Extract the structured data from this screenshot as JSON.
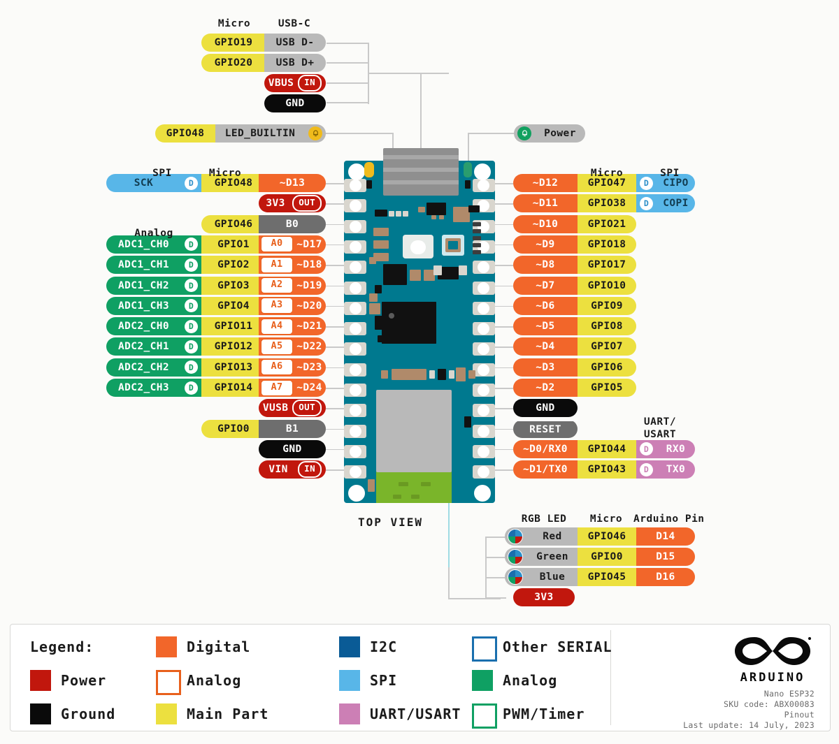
{
  "title": "Arduino Nano ESP32 Pinout",
  "board": {
    "view_label": "TOP VIEW"
  },
  "headers": {
    "micro_usb": "Micro",
    "usbc": "USB-C",
    "spi_left": "SPI",
    "micro_left": "Micro",
    "analog_left": "Analog",
    "micro_right": "Micro",
    "spi_right": "SPI",
    "uart_right": "UART/\nUSART",
    "uart_right_l1": "UART/",
    "uart_right_l2": "USART",
    "rgb_led": "RGB LED",
    "micro_rgb": "Micro",
    "arduino_pin": "Arduino Pin"
  },
  "usb_group": [
    {
      "micro": "GPIO19",
      "name": "USB D-",
      "type": "gray"
    },
    {
      "micro": "GPIO20",
      "name": "USB D+",
      "type": "gray"
    },
    {
      "micro": "",
      "name": "VBUS",
      "type": "power",
      "io": "IN"
    },
    {
      "micro": "",
      "name": "GND",
      "type": "ground"
    }
  ],
  "led_rows": [
    {
      "micro": "GPIO48",
      "name": "LED_BUILTIN",
      "type": "gray",
      "led": "yellow"
    },
    {
      "micro": "",
      "name": "Power",
      "type": "gray",
      "led": "green"
    }
  ],
  "left_pins": [
    {
      "func": "SCK",
      "func_type": "spi",
      "badge": "D",
      "micro": "GPIO48",
      "name": "~D13",
      "type": "digital"
    },
    {
      "func": "",
      "micro": "",
      "name": "3V3",
      "type": "power",
      "io": "OUT"
    },
    {
      "func": "",
      "micro": "GPIO46",
      "name": "B0",
      "type": "gray"
    },
    {
      "func": "ADC1_CH0",
      "func_type": "analog",
      "badge": "D",
      "micro": "GPIO1",
      "abox": "A0",
      "name": "~D17",
      "type": "digital"
    },
    {
      "func": "ADC1_CH1",
      "func_type": "analog",
      "badge": "D",
      "micro": "GPIO2",
      "abox": "A1",
      "name": "~D18",
      "type": "digital"
    },
    {
      "func": "ADC1_CH2",
      "func_type": "analog",
      "badge": "D",
      "micro": "GPIO3",
      "abox": "A2",
      "name": "~D19",
      "type": "digital"
    },
    {
      "func": "ADC1_CH3",
      "func_type": "analog",
      "badge": "D",
      "micro": "GPIO4",
      "abox": "A3",
      "name": "~D20",
      "type": "digital"
    },
    {
      "func": "ADC2_CH0",
      "func_type": "analog",
      "badge": "D",
      "micro": "GPIO11",
      "abox": "A4",
      "name": "~D21",
      "type": "digital"
    },
    {
      "func": "ADC2_CH1",
      "func_type": "analog",
      "badge": "D",
      "micro": "GPIO12",
      "abox": "A5",
      "name": "~D22",
      "type": "digital"
    },
    {
      "func": "ADC2_CH2",
      "func_type": "analog",
      "badge": "D",
      "micro": "GPIO13",
      "abox": "A6",
      "name": "~D23",
      "type": "digital"
    },
    {
      "func": "ADC2_CH3",
      "func_type": "analog",
      "badge": "D",
      "micro": "GPIO14",
      "abox": "A7",
      "name": "~D24",
      "type": "digital"
    },
    {
      "func": "",
      "micro": "",
      "name": "VUSB",
      "type": "power",
      "io": "OUT"
    },
    {
      "func": "",
      "micro": "GPIO0",
      "name": "B1",
      "type": "gray"
    },
    {
      "func": "",
      "micro": "",
      "name": "GND",
      "type": "ground"
    },
    {
      "func": "",
      "micro": "",
      "name": "VIN",
      "type": "power",
      "io": "IN"
    }
  ],
  "right_pins": [
    {
      "name": "~D12",
      "type": "digital",
      "micro": "GPIO47",
      "func": "CIPO",
      "func_type": "spi",
      "badge": "D"
    },
    {
      "name": "~D11",
      "type": "digital",
      "micro": "GPIO38",
      "func": "COPI",
      "func_type": "spi",
      "badge": "D"
    },
    {
      "name": "~D10",
      "type": "digital",
      "micro": "GPIO21",
      "func": ""
    },
    {
      "name": "~D9",
      "type": "digital",
      "micro": "GPIO18",
      "func": ""
    },
    {
      "name": "~D8",
      "type": "digital",
      "micro": "GPIO17",
      "func": ""
    },
    {
      "name": "~D7",
      "type": "digital",
      "micro": "GPIO10",
      "func": ""
    },
    {
      "name": "~D6",
      "type": "digital",
      "micro": "GPIO9",
      "func": ""
    },
    {
      "name": "~D5",
      "type": "digital",
      "micro": "GPIO8",
      "func": ""
    },
    {
      "name": "~D4",
      "type": "digital",
      "micro": "GPIO7",
      "func": ""
    },
    {
      "name": "~D3",
      "type": "digital",
      "micro": "GPIO6",
      "func": ""
    },
    {
      "name": "~D2",
      "type": "digital",
      "micro": "GPIO5",
      "func": ""
    },
    {
      "name": "GND",
      "type": "ground",
      "micro": "",
      "func": ""
    },
    {
      "name": "RESET",
      "type": "gray",
      "overline": true,
      "micro": "",
      "func": ""
    },
    {
      "name": "~D0/RX0",
      "type": "digital",
      "micro": "GPIO44",
      "func": "RX0",
      "func_type": "uart",
      "badge": "D"
    },
    {
      "name": "~D1/TX0",
      "type": "digital",
      "micro": "GPIO43",
      "func": "TX0",
      "func_type": "uart",
      "badge": "D"
    }
  ],
  "rgb_rows": [
    {
      "color": "Red",
      "micro": "GPIO46",
      "pin": "D14"
    },
    {
      "color": "Green",
      "micro": "GPIO0",
      "pin": "D15"
    },
    {
      "color": "Blue",
      "micro": "GPIO45",
      "pin": "D16"
    },
    {
      "color": "3V3",
      "micro": "",
      "pin": "",
      "power": true
    }
  ],
  "legend": {
    "title": "Legend:",
    "col1": [
      {
        "label": "Power",
        "color": "#c1170d",
        "style": "fill"
      },
      {
        "label": "Ground",
        "color": "#0a0a0a",
        "style": "fill"
      }
    ],
    "col2": [
      {
        "label": "Digital",
        "color": "#f2662a",
        "style": "fill"
      },
      {
        "label": "Analog",
        "color": "#e8601c",
        "style": "outline"
      },
      {
        "label": "Main Part",
        "color": "#ece03f",
        "style": "fill"
      }
    ],
    "col3": [
      {
        "label": "I2C",
        "color": "#0a5b96",
        "style": "fill"
      },
      {
        "label": "SPI",
        "color": "#58b6e8",
        "style": "fill"
      },
      {
        "label": "UART/USART",
        "color": "#cc7fb5",
        "style": "fill"
      }
    ],
    "col4": [
      {
        "label": "Other SERIAL",
        "color": "#1a6fae",
        "style": "outline"
      },
      {
        "label": "Analog",
        "color": "#0fa063",
        "style": "fill"
      },
      {
        "label": "PWM/Timer",
        "color": "#0fa063",
        "style": "outline"
      }
    ]
  },
  "brand": {
    "logo_text": "ARDUINO",
    "line1": "Nano ESP32",
    "line2": "SKU code: ABX00083",
    "line3": "Pinout",
    "line4": "Last update: 14 July, 2023"
  }
}
